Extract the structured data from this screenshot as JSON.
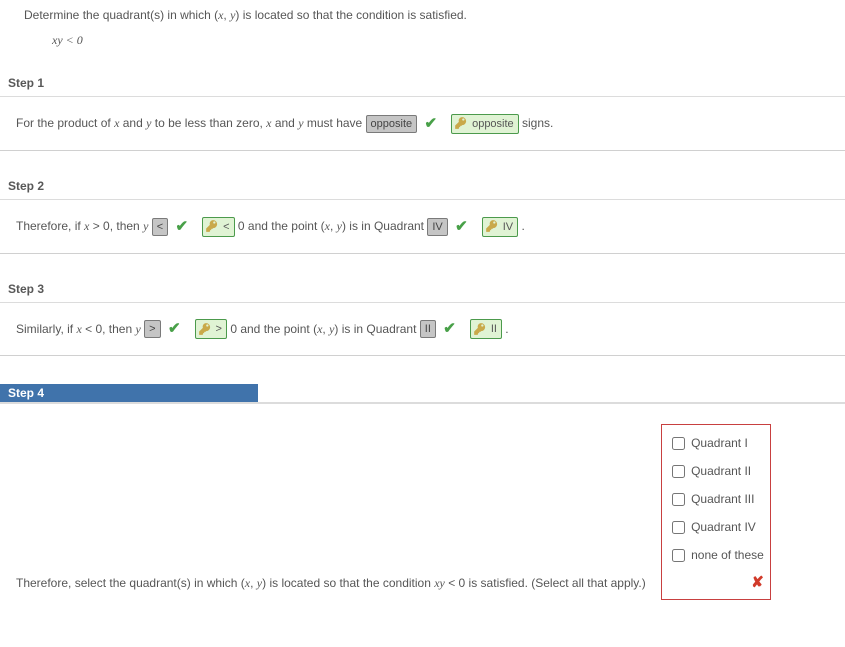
{
  "question": {
    "prompt_before": "Determine the quadrant(s) in which (",
    "varx": "x",
    "comma": ", ",
    "vary": "y",
    "prompt_after": ") is located so that the condition is satisfied.",
    "condition": "xy < 0"
  },
  "step1": {
    "heading": "Step 1",
    "text_a": "For the product of ",
    "x": "x",
    "and": " and ",
    "y": "y",
    "text_b": " to be less than zero, ",
    "x2": "x",
    "and2": " and ",
    "y2": "y",
    "text_c": " must have ",
    "answer_gray": "opposite",
    "answer_key": "opposite",
    "text_d": " signs."
  },
  "step2": {
    "heading": "Step 2",
    "text_a": "Therefore, if ",
    "x": "x",
    "gt0": " > 0, then ",
    "y": "y",
    "answer1_gray": "<",
    "answer1_key": "<",
    "text_b": " 0 and the point (",
    "x2": "x",
    "comma": ", ",
    "y2": "y",
    "text_c": ") is in Quadrant ",
    "answer2_gray": "IV",
    "answer2_key": "IV",
    "period": "."
  },
  "step3": {
    "heading": "Step 3",
    "text_a": "Similarly, if ",
    "x": "x",
    "lt0": " < 0, then ",
    "y": "y",
    "answer1_gray": ">",
    "answer1_key": ">",
    "text_b": " 0 and the point (",
    "x2": "x",
    "comma": ", ",
    "y2": "y",
    "text_c": ") is in Quadrant ",
    "answer2_gray": "II",
    "answer2_key": "II",
    "period": "."
  },
  "step4": {
    "heading": "Step 4",
    "text_a": "Therefore, select the quadrant(s) in which (",
    "x": "x",
    "comma": ", ",
    "y": "y",
    "text_b": ") is located so that the condition ",
    "cond": "xy",
    "lt0": " < 0 is satisfied. (Select all that apply.)",
    "options": {
      "o1": "Quadrant I",
      "o2": "Quadrant II",
      "o3": "Quadrant III",
      "o4": "Quadrant IV",
      "o5": "none of these"
    }
  }
}
